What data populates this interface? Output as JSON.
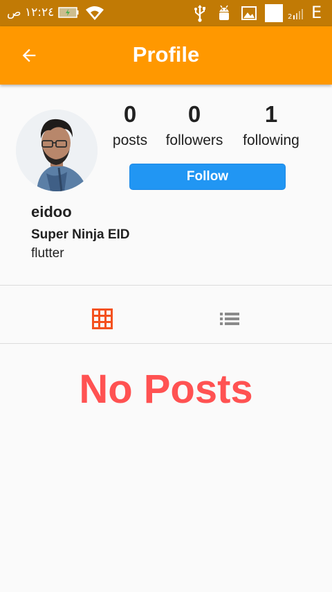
{
  "status_bar": {
    "time": "١٢:٢٤ ص",
    "network_type": "E",
    "icons": [
      "battery-icon",
      "wifi-icon",
      "usb-icon",
      "android-icon",
      "image-icon",
      "notification-icon",
      "signal-icon"
    ]
  },
  "app_bar": {
    "title": "Profile",
    "back_icon": "arrow-left-icon",
    "color": "#ff9800"
  },
  "profile": {
    "stats": [
      {
        "value": "0",
        "label": "posts"
      },
      {
        "value": "0",
        "label": "followers"
      },
      {
        "value": "1",
        "label": "following"
      }
    ],
    "follow_label": "Follow",
    "username": "eidoo",
    "full_name": "Super Ninja EID",
    "bio": "flutter"
  },
  "view_toggle": {
    "grid_icon": "grid-icon",
    "list_icon": "list-icon",
    "active": "grid",
    "active_color": "#f4511e"
  },
  "empty_state": {
    "text": "No Posts",
    "color": "#ff5252"
  },
  "colors": {
    "status_bar": "#c17a05",
    "app_bar": "#ff9800",
    "follow_button": "#2196f3",
    "background": "#fafafa"
  }
}
